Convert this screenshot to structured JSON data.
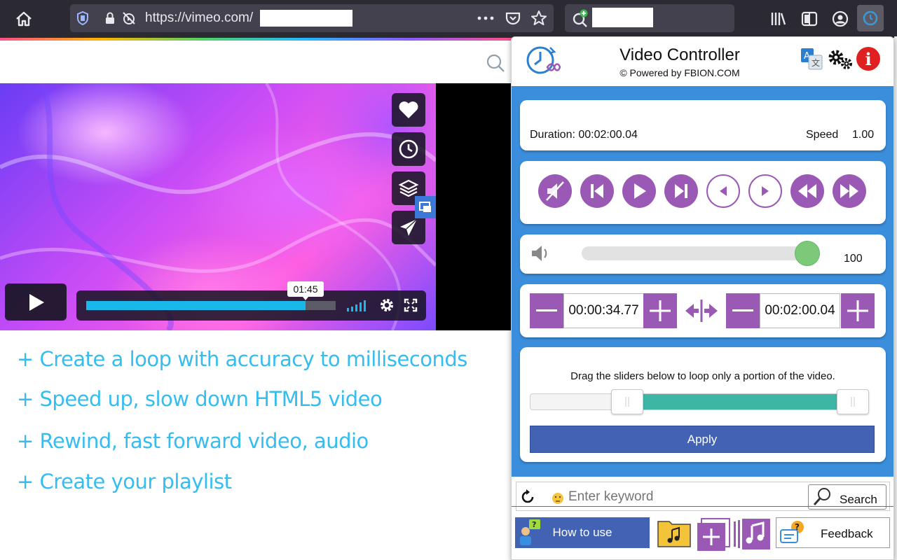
{
  "browser": {
    "url_prefix": "https://vimeo.com/"
  },
  "video_player": {
    "time_tooltip": "01:45",
    "progress_fraction": 0.88
  },
  "features": [
    "+ Create a loop with accuracy to milliseconds",
    "+ Speed up, slow down HTML5 video",
    "+ Rewind, fast forward video, audio",
    "+ Create your playlist"
  ],
  "popup": {
    "title": "Video Controller",
    "subtitle": "© Powered by FBION.COM",
    "duration_label": "Duration: 00:02:00.04",
    "speed_label": "Speed",
    "speed_value": "1.00",
    "volume_value": "100",
    "volume_fraction": 1.0,
    "loop_start": "00:00:34.77",
    "loop_end": "00:02:00.04",
    "loop_instruction": "Drag the sliders below to loop only a portion of the video.",
    "range_start_fraction": 0.29,
    "range_end_fraction": 0.96,
    "apply_label": "Apply",
    "search_placeholder": "Enter keyword",
    "search_button": "Search",
    "how_to_use_label": "How to use",
    "feedback_label": "Feedback"
  },
  "colors": {
    "accent_purple": "#9b59b6",
    "popup_blue": "#3b8edc",
    "apply_blue": "#4263b3",
    "feature_text": "#36bdf0",
    "range_green": "#3db6a6",
    "volume_knob": "#7cc97a",
    "progress_blue": "#1ab7ea"
  }
}
